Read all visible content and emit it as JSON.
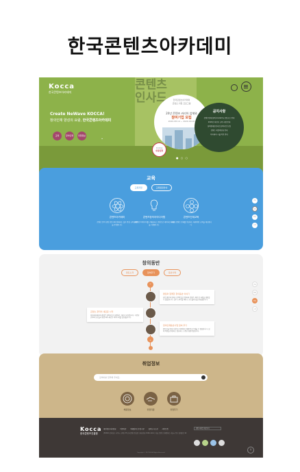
{
  "heading": "한국콘텐츠아카데미",
  "hero": {
    "logo": "Kocca",
    "logo_sub": "한국콘텐츠아카데미",
    "sign_text": "콘텐츠 인사드",
    "tagline": "Create NeWave KOCCA!",
    "subline_prefix": "창의인재 양성의 요람,",
    "subline_bold": "한국콘텐츠아카데미",
    "buttons": [
      "교육",
      "창의인재",
      "취업정보"
    ],
    "circle_line1": "한국콘텐츠아카데미",
    "circle_line2": "콘텐츠 취업 프로그램",
    "circle_line3": "20년 콘텐츠 커리어 업체와",
    "circle_line4": "참여기업 모집",
    "circle_line5": "2020.08.14 ~ 2020.09.04",
    "notice_title": "공지사항",
    "notices": [
      "콘텐츠인재 창의 Academy 모집공고 안내",
      "2020년 하반기 교육 과정 안내",
      "창의인재동반사업 참여기업 모집",
      "콘텐츠 취업박람회 안내",
      "아카데미 시설 이용 안내"
    ],
    "badge_line1": "입학안내",
    "badge_line2": "수강신청"
  },
  "education": {
    "title": "교육",
    "tabs": [
      "교육과정",
      "교육일정안내"
    ],
    "items": [
      {
        "label": "콘텐츠아카데미",
        "desc": "콘텐츠 분야 현업 전문가와 함께하는 실무 중심 교육 과정을 운영합니다."
      },
      {
        "label": "콘텐츠창의아이디어랩",
        "desc": "창의적인 아이디어를 구체화하고 콘텐츠로 제작하는 과정을 지원합니다."
      },
      {
        "label": "콘텐츠인재교육",
        "desc": "차세대 콘텐츠 인재를 양성하는 체계적인 교육을 제공합니다."
      }
    ],
    "side": [
      "교육",
      "창의",
      "취업",
      "소개"
    ]
  },
  "creative": {
    "title": "창의동반",
    "tabs": [
      "멘토소개",
      "참여후기",
      "동반사례"
    ],
    "cards": [
      {
        "title": "멘토와 함께한 창의동반 이야기",
        "body": "현업 멘토와 함께 프로젝트를 진행하며 콘텐츠 제작 전 과정을 경험할 수 있었습니다. 실무 노하우를 배우고 포트폴리오를 완성했습니다."
      },
      {
        "title": "콘텐츠 창작의 새로운 시작",
        "body": "아카데미에서의 경험은 창작자로서 성장하는 계기가 되었습니다. 다양한 분야의 동료들과 협업하며 새로운 아이디어를 발견했습니다."
      },
      {
        "title": "창의인재동반사업 참여 후기",
        "body": "멘토링을 통해 기획부터 제작까지 체계적으로 배울 수 있었습니다. 실제 작품을 완성하고 발표하는 소중한 경험이었습니다."
      }
    ],
    "side": [
      "교육",
      "창의",
      "취업",
      "소개"
    ]
  },
  "jobs": {
    "title": "취업정보",
    "search_placeholder": "검색어를 입력해 주세요.",
    "items": [
      "채용정보",
      "취업지원",
      "취업후기"
    ]
  },
  "footer": {
    "logo": "Kocca",
    "logo_sub": "한국콘텐츠진흥원",
    "links": [
      "개인정보처리방침",
      "이용약관",
      "이메일무단수집거부",
      "찾아오시는길",
      "사이트맵"
    ],
    "address": "(58326) 전라남도 나주시 교육길 35 한국콘텐츠진흥원 | 대표전화 1566-1114 | 서울 콘텐츠 인재캠퍼스 서울시 중구 청계천로 40",
    "family_label": "관련 사이트 바로가기",
    "copyright": "Copyright © KOCCA. All Rights Reserved.",
    "top_label": "↑"
  },
  "colors": {
    "hero": "#8db24a",
    "education": "#4a9ede",
    "creative_accent": "#e8925a",
    "jobs": "#cdb68a",
    "footer": "#3e3836"
  }
}
